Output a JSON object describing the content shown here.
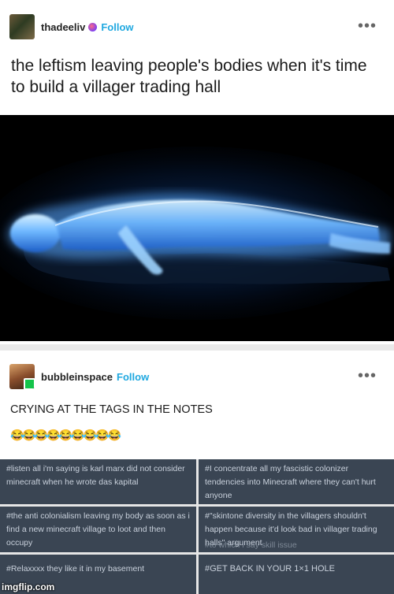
{
  "post1": {
    "username": "thadeeliv",
    "follow_label": "Follow",
    "menu_label": "•••",
    "title": "the leftism leaving people's bodies when it's time to build a villager trading hall"
  },
  "post2": {
    "username": "bubbleinspace",
    "follow_label": "Follow",
    "menu_label": "•••",
    "text": "CRYING AT THE TAGS IN THE NOTES",
    "emojis": "😂😂😂😂😂😂😂😂😂",
    "tags": [
      "#listen all i'm saying is karl marx did not consider minecraft when he wrote das kapital",
      "#I concentrate all my fascistic colonizer tendencies into Minecraft where they can't hurt anyone",
      "#the anti colonialism leaving my body as soon as i find a new minecraft village to loot and then occupy",
      "#\"skintone diversity in the villagers shouldn't happen because it'd look bad in villager trading halls\" argument",
      "#Relaxxxx they like it in my basement",
      "#GET BACK IN YOUR 1×1 HOLE"
    ],
    "tag_overflow": "#to which i say skill issue"
  },
  "watermark": "imgflip.com"
}
